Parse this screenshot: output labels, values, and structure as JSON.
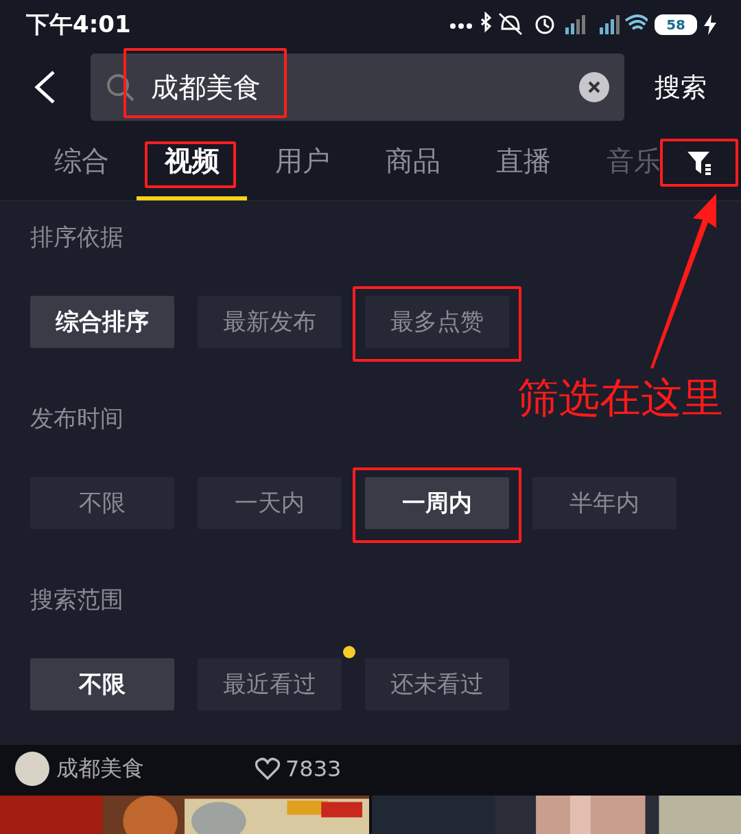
{
  "status_bar": {
    "time": "下午4:01",
    "battery": "58"
  },
  "search": {
    "value": "成都美食",
    "highlighted": true,
    "button": "搜索"
  },
  "tabs": [
    {
      "label": "综合",
      "selected": false,
      "highlighted": false
    },
    {
      "label": "视频",
      "selected": true,
      "highlighted": true
    },
    {
      "label": "用户",
      "selected": false,
      "highlighted": false
    },
    {
      "label": "商品",
      "selected": false,
      "highlighted": false
    },
    {
      "label": "直播",
      "selected": false,
      "highlighted": false
    },
    {
      "label": "音乐",
      "selected": false,
      "highlighted": false
    }
  ],
  "filter_button": {
    "highlighted": true
  },
  "filter_groups": [
    {
      "title": "排序依据",
      "options": [
        {
          "label": "综合排序",
          "selected": true,
          "highlighted": false,
          "dot": false
        },
        {
          "label": "最新发布",
          "selected": false,
          "highlighted": false,
          "dot": false
        },
        {
          "label": "最多点赞",
          "selected": false,
          "highlighted": true,
          "dot": false
        }
      ]
    },
    {
      "title": "发布时间",
      "options": [
        {
          "label": "不限",
          "selected": false,
          "highlighted": false,
          "dot": false
        },
        {
          "label": "一天内",
          "selected": false,
          "highlighted": false,
          "dot": false
        },
        {
          "label": "一周内",
          "selected": true,
          "highlighted": true,
          "dot": false
        },
        {
          "label": "半年内",
          "selected": false,
          "highlighted": false,
          "dot": false
        }
      ]
    },
    {
      "title": "搜索范围",
      "options": [
        {
          "label": "不限",
          "selected": true,
          "highlighted": false,
          "dot": false
        },
        {
          "label": "最近看过",
          "selected": false,
          "highlighted": false,
          "dot": true
        },
        {
          "label": "还未看过",
          "selected": false,
          "highlighted": false,
          "dot": false
        }
      ]
    }
  ],
  "result": {
    "author": "成都美食",
    "likes": "7833"
  },
  "annotation": {
    "text": "筛选在这里"
  }
}
